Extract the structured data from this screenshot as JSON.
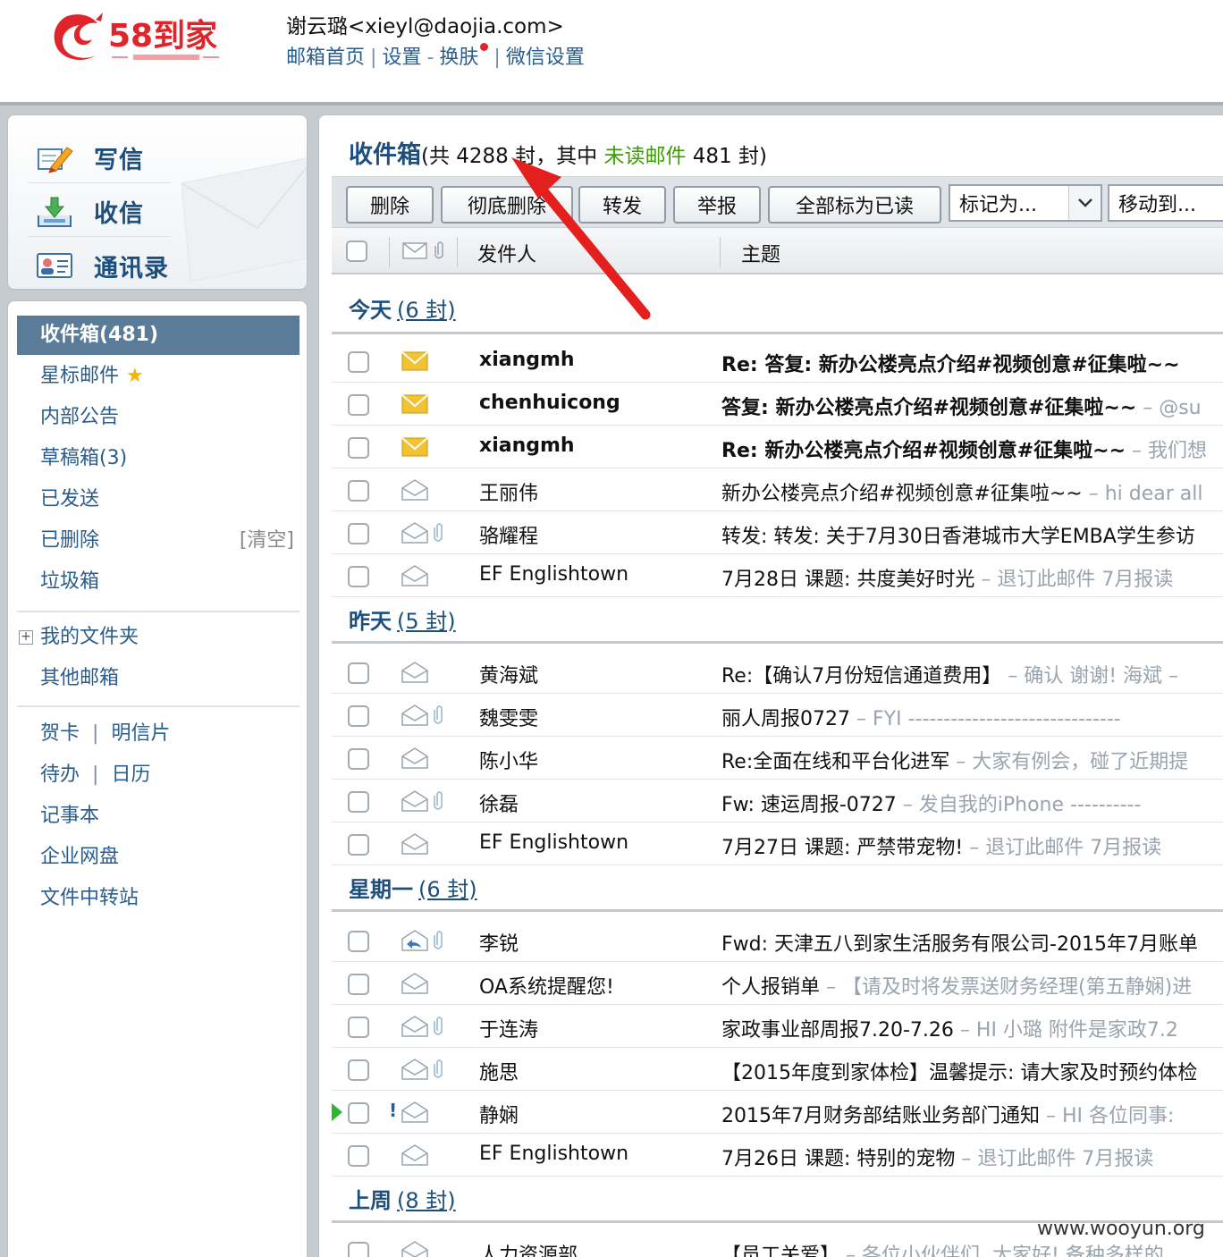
{
  "header": {
    "user": "谢云璐<xieyl@daojia.com>",
    "links": [
      "邮箱首页",
      "设置",
      "换肤",
      "微信设置"
    ],
    "separators": [
      "|",
      "-",
      "|"
    ]
  },
  "quick_actions": [
    "写信",
    "收信",
    "通讯录"
  ],
  "folders": {
    "inbox": "收件箱(481)",
    "starred": "星标邮件",
    "notice": "内部公告",
    "drafts": "草稿箱(3)",
    "sent": "已发送",
    "deleted": "已删除",
    "clear": "[清空]",
    "spam": "垃圾箱",
    "my_folders": "我的文件夹",
    "other_mail": "其他邮箱",
    "card": "贺卡",
    "postcard": "明信片",
    "todo": "待办",
    "calendar": "日历",
    "notes": "记事本",
    "netdisk": "企业网盘",
    "transfer": "文件中转站"
  },
  "inbox_title": {
    "name": "收件箱",
    "part1": "(共 4288 封，其中 ",
    "unread_label": "未读邮件",
    "part2": " 481 封)"
  },
  "toolbar": {
    "delete": "删除",
    "delete_forever": "彻底删除",
    "forward": "转发",
    "report": "举报",
    "mark_all_read": "全部标为已读",
    "mark_as": "标记为...",
    "move_to": "移动到..."
  },
  "columns": {
    "sender": "发件人",
    "subject": "主题"
  },
  "groups": {
    "today": {
      "label": "今天",
      "count": "(6 封)"
    },
    "yesterday": {
      "label": "昨天",
      "count": "(5 封)"
    },
    "monday": {
      "label": "星期一",
      "count": "(6 封)"
    },
    "last_week": {
      "label": "上周",
      "count": "(8 封)"
    }
  },
  "emails": [
    {
      "sender": "xiangmh",
      "subject": "Re: 答复: 新办公楼亮点介绍#视频创意#征集啦~~",
      "preview": ""
    },
    {
      "sender": "chenhuicong",
      "subject": "答复: 新办公楼亮点介绍#视频创意#征集啦~~",
      "preview": " – @su"
    },
    {
      "sender": "xiangmh",
      "subject": "Re: 新办公楼亮点介绍#视频创意#征集啦~~",
      "preview": " – 我们想"
    },
    {
      "sender": "王丽伟",
      "subject": "新办公楼亮点介绍#视频创意#征集啦~~",
      "preview": " – hi dear all"
    },
    {
      "sender": "骆耀程",
      "subject": "转发: 转发: 关于7月30日香港城市大学EMBA学生参访",
      "preview": ""
    },
    {
      "sender": "EF Englishtown",
      "subject": "7月28日 课题:  共度美好时光",
      "preview": " – 退订此邮件 7月报读"
    },
    {
      "sender": "黄海斌",
      "subject": "Re:【确认7月份短信通道费用】",
      "preview": " – 确认 谢谢!  海斌 –"
    },
    {
      "sender": "魏雯雯",
      "subject": "丽人周报0727",
      "preview": " – FYI ------------------------------"
    },
    {
      "sender": "陈小华",
      "subject": "Re:全面在线和平台化进军",
      "preview": " – 大家有例会，碰了近期提"
    },
    {
      "sender": "徐磊",
      "subject": "Fw: 速运周报-0727",
      "preview": " – 发自我的iPhone ----------"
    },
    {
      "sender": "EF Englishtown",
      "subject": "7月27日 课题:  严禁带宠物!",
      "preview": " – 退订此邮件 7月报读"
    },
    {
      "sender": "李锐",
      "subject": "Fwd: 天津五八到家生活服务有限公司-2015年7月账单",
      "preview": ""
    },
    {
      "sender": "OA系统提醒您!",
      "subject": "个人报销单",
      "preview": " – 【请及时将发票送财务经理(第五静娴)进"
    },
    {
      "sender": "于连涛",
      "subject": "家政事业部周报7.20-7.26",
      "preview": " – HI 小璐 附件是家政7.2"
    },
    {
      "sender": "施思",
      "subject": "【2015年度到家体检】温馨提示: 请大家及时预约体检",
      "preview": ""
    },
    {
      "sender": "静娴",
      "subject": "2015年7月财务部结账业务部门通知",
      "preview": " – HI 各位同事:"
    },
    {
      "sender": "EF Englishtown",
      "subject": "7月26日 课题:  特别的宠物",
      "preview": " – 退订此邮件 7月报读"
    },
    {
      "sender": "人力资源部",
      "subject": "【员工关爱】",
      "preview": " – 各位小伙伴们, 大家好! 备种多样的"
    }
  ],
  "watermark": "www.wooyun.org",
  "colors": {
    "link_blue": "#2a5d8f",
    "title_blue": "#1d4f7e",
    "active_folder": "#5b7c98",
    "unread_green": "#3aa000",
    "unread_envelope": "#f2c230",
    "annotation_red": "#e3201d",
    "brand_red": "#e0242a"
  },
  "icons": {
    "compose": "pencil-paper-icon",
    "receive": "download-tray-icon",
    "contacts": "address-card-icon",
    "unread": "envelope-closed-icon",
    "read": "envelope-open-icon",
    "attachment": "paperclip-icon",
    "replied": "reply-arrow-icon"
  }
}
